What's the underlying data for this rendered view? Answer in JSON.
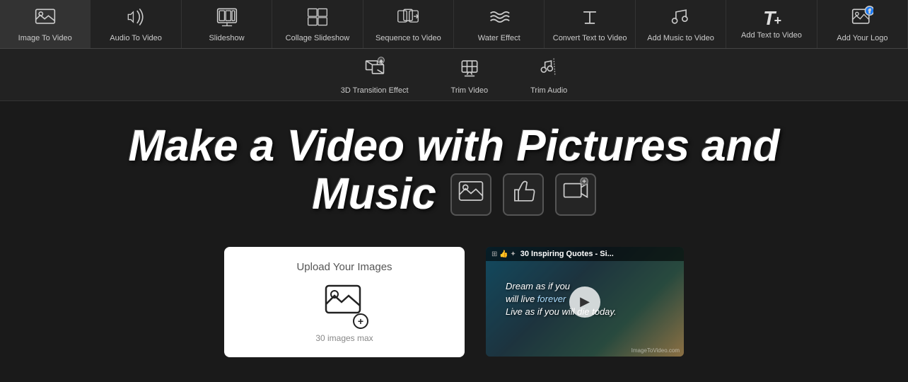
{
  "nav": {
    "items": [
      {
        "id": "image-to-video",
        "label": "Image To Video",
        "icon": "🖼️"
      },
      {
        "id": "audio-to-video",
        "label": "Audio To Video",
        "icon": "👍"
      },
      {
        "id": "slideshow",
        "label": "Slideshow",
        "icon": "🎬"
      },
      {
        "id": "collage-slideshow",
        "label": "Collage Slideshow",
        "icon": "📋"
      },
      {
        "id": "sequence-to-video",
        "label": "Sequence to Video",
        "icon": "🎞️"
      },
      {
        "id": "water-effect",
        "label": "Water Effect",
        "icon": "〰️"
      },
      {
        "id": "convert-text-to-video",
        "label": "Convert Text to Video",
        "icon": "📝"
      },
      {
        "id": "add-music-to-video",
        "label": "Add Music to Video",
        "icon": "👍"
      },
      {
        "id": "add-text-to-video",
        "label": "Add Text to Video",
        "icon": "T+"
      },
      {
        "id": "add-your-logo",
        "label": "Add Your Logo",
        "icon": "🖼️"
      }
    ]
  },
  "second_nav": {
    "items": [
      {
        "id": "3d-transition",
        "label": "3D Transition Effect",
        "icon": "✦"
      },
      {
        "id": "trim-video",
        "label": "Trim Video",
        "icon": "✂"
      },
      {
        "id": "trim-audio",
        "label": "Trim Audio",
        "icon": "🎵"
      }
    ]
  },
  "hero": {
    "title_line1": "Make a Video with Pictures and",
    "title_line2": "Music"
  },
  "upload": {
    "label": "Upload Your Images",
    "hint": "30 images max"
  },
  "video_thumb": {
    "title": "30 Inspiring Quotes - Si...",
    "quote": "Dream as if you\nwill live forever\nLive as if you will die today.",
    "watermark": "ImageToVideo.com"
  }
}
